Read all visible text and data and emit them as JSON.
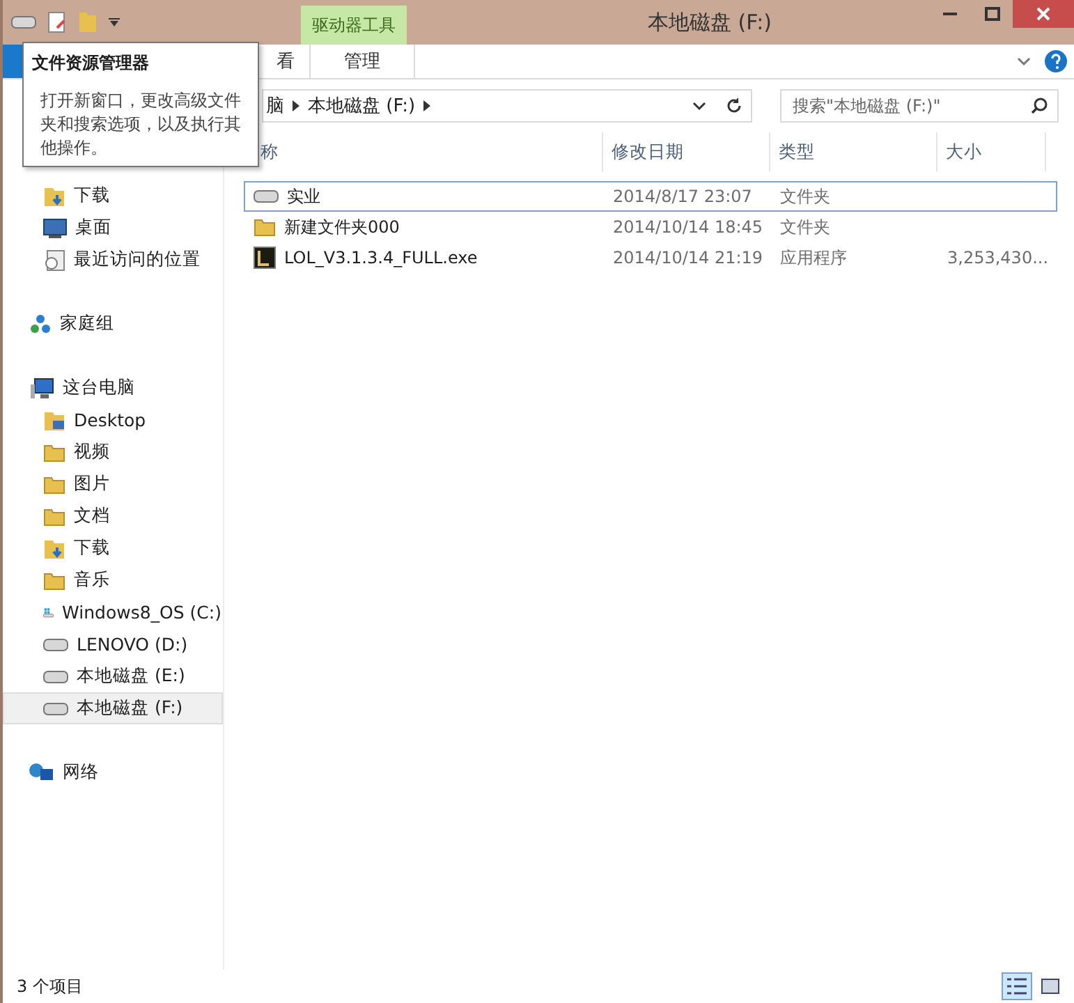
{
  "title_bar": {
    "title": "本地磁盘 (F:)",
    "context_group": "驱动器工具"
  },
  "ribbon": {
    "tabs": [
      "看",
      "管理"
    ]
  },
  "address_bar": {
    "crumbs": [
      "脑",
      "本地磁盘 (F:)"
    ]
  },
  "search": {
    "placeholder": "搜索\"本地磁盘 (F:)\""
  },
  "sidebar": {
    "sections": [
      {
        "items": [
          {
            "label": "下载",
            "kind": "downloads",
            "selected": false
          },
          {
            "label": "桌面",
            "kind": "desktop",
            "selected": false
          },
          {
            "label": "最近访问的位置",
            "kind": "recent",
            "selected": false
          }
        ]
      },
      {
        "label": "家庭组",
        "kind": "homegroup"
      },
      {
        "label": "这台电脑",
        "kind": "computer",
        "items": [
          {
            "label": "Desktop",
            "kind": "desktop-folder",
            "selected": false
          },
          {
            "label": "视频",
            "kind": "folder",
            "selected": false
          },
          {
            "label": "图片",
            "kind": "folder",
            "selected": false
          },
          {
            "label": "文档",
            "kind": "folder",
            "selected": false
          },
          {
            "label": "下载",
            "kind": "downloads",
            "selected": false
          },
          {
            "label": "音乐",
            "kind": "folder",
            "selected": false
          },
          {
            "label": "Windows8_OS (C:)",
            "kind": "system-drive",
            "selected": false
          },
          {
            "label": "LENOVO (D:)",
            "kind": "drive",
            "selected": false
          },
          {
            "label": "本地磁盘 (E:)",
            "kind": "drive",
            "selected": false
          },
          {
            "label": "本地磁盘 (F:)",
            "kind": "drive",
            "selected": true
          }
        ]
      },
      {
        "label": "网络",
        "kind": "network"
      }
    ]
  },
  "table": {
    "columns": [
      "称",
      "修改日期",
      "类型",
      "大小"
    ],
    "rows": [
      {
        "name": "实业",
        "kind": "drive",
        "modified": "2014/8/17 23:07",
        "type": "文件夹",
        "focused": true
      },
      {
        "name": "新建文件夹000",
        "kind": "folder",
        "modified": "2014/10/14 18:45",
        "type": "文件夹",
        "focused": false
      },
      {
        "name": "LOL_V3.1.3.4_FULL.exe",
        "kind": "app",
        "modified": "2014/10/14 21:19",
        "type": "应用程序",
        "size": "3,253,430...",
        "focused": false
      }
    ]
  },
  "status_bar": {
    "count": "3 个项目",
    "views": [
      {
        "kind": "details",
        "selected": true
      },
      {
        "kind": "large-icons",
        "selected": false
      }
    ]
  },
  "tooltip": {
    "title": "文件资源管理器",
    "text": "打开新窗口，更改高级文件夹和搜索选项，以及执行其他操作。"
  }
}
